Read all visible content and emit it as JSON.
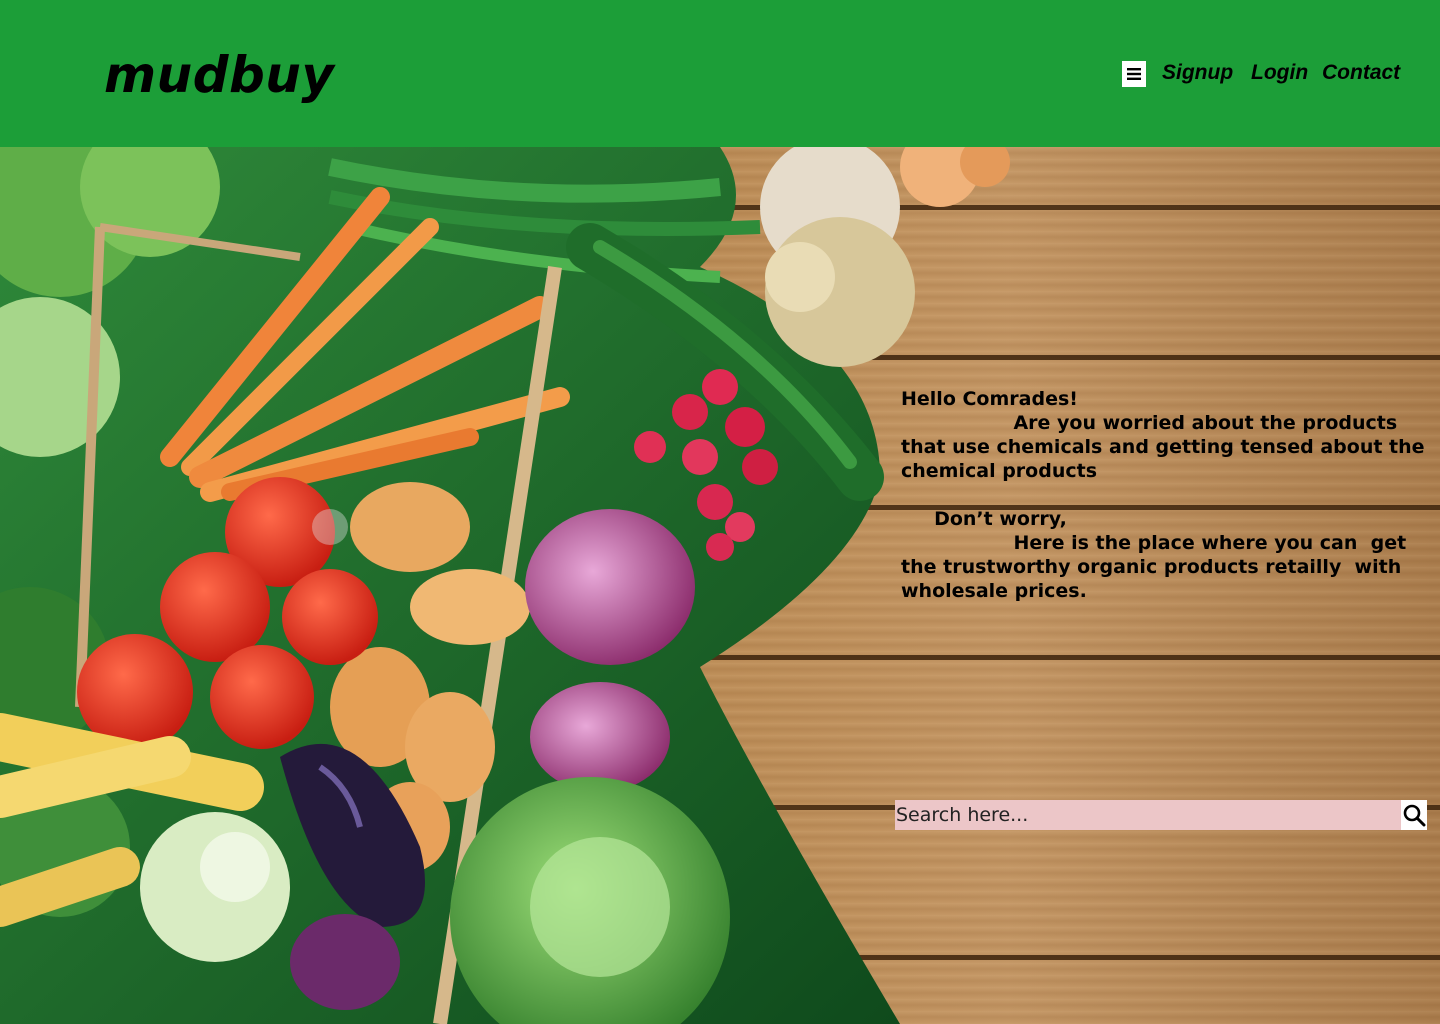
{
  "brand": {
    "name": "mudbuy",
    "color": "#1c9e38"
  },
  "nav": {
    "menu_icon": "hamburger-menu-icon",
    "links": [
      "Signup",
      "Login",
      "Contact"
    ]
  },
  "hero": {
    "greeting": "Hello Comrades!",
    "line1": "                 Are you worried about the products that use chemicals and getting tensed about the chemical products",
    "line2": "     Don’t worry,",
    "line3": "                 Here is the place where you can  get the trustworthy organic products retailly  with wholesale prices."
  },
  "search": {
    "placeholder": "Search here...",
    "icon": "search-icon",
    "background": "#ecc6c8"
  }
}
